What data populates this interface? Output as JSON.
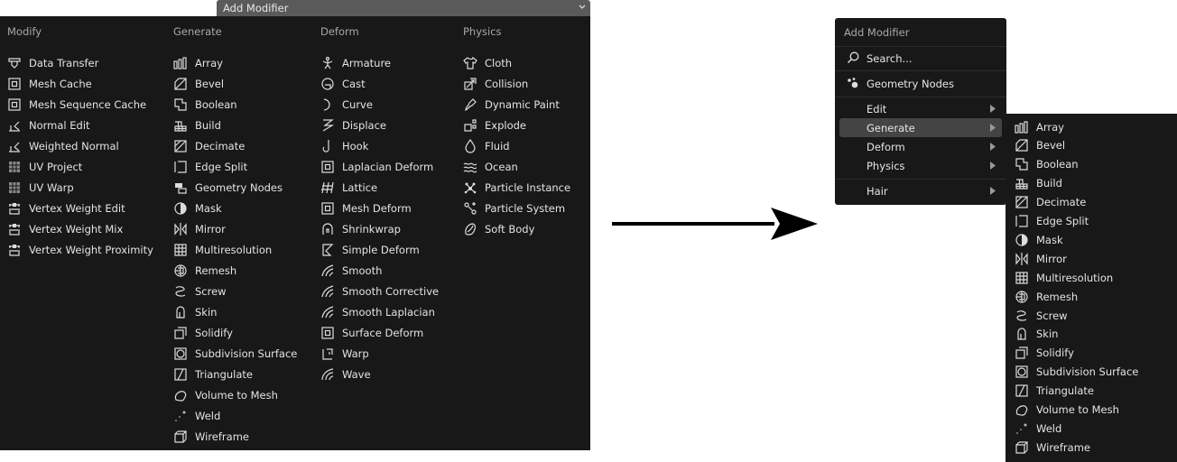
{
  "left_menu": {
    "title": "Add Modifier",
    "columns": [
      {
        "header": "Modify",
        "items": [
          {
            "label": "Data Transfer",
            "icon": "data-transfer-icon"
          },
          {
            "label": "Mesh Cache",
            "icon": "mesh-cache-icon"
          },
          {
            "label": "Mesh Sequence Cache",
            "icon": "mesh-sequence-cache-icon"
          },
          {
            "label": "Normal Edit",
            "icon": "normal-edit-icon"
          },
          {
            "label": "Weighted Normal",
            "icon": "weighted-normal-icon"
          },
          {
            "label": "UV Project",
            "icon": "uv-project-icon"
          },
          {
            "label": "UV Warp",
            "icon": "uv-warp-icon"
          },
          {
            "label": "Vertex Weight Edit",
            "icon": "vertex-weight-icon"
          },
          {
            "label": "Vertex Weight Mix",
            "icon": "vertex-weight-icon"
          },
          {
            "label": "Vertex Weight Proximity",
            "icon": "vertex-weight-icon"
          }
        ]
      },
      {
        "header": "Generate",
        "items": [
          {
            "label": "Array",
            "icon": "array-icon"
          },
          {
            "label": "Bevel",
            "icon": "bevel-icon"
          },
          {
            "label": "Boolean",
            "icon": "boolean-icon"
          },
          {
            "label": "Build",
            "icon": "build-icon"
          },
          {
            "label": "Decimate",
            "icon": "decimate-icon"
          },
          {
            "label": "Edge Split",
            "icon": "edge-split-icon"
          },
          {
            "label": "Geometry Nodes",
            "icon": "geometry-nodes-icon"
          },
          {
            "label": "Mask",
            "icon": "mask-icon"
          },
          {
            "label": "Mirror",
            "icon": "mirror-icon"
          },
          {
            "label": "Multiresolution",
            "icon": "multiresolution-icon"
          },
          {
            "label": "Remesh",
            "icon": "remesh-icon"
          },
          {
            "label": "Screw",
            "icon": "screw-icon"
          },
          {
            "label": "Skin",
            "icon": "skin-icon"
          },
          {
            "label": "Solidify",
            "icon": "solidify-icon"
          },
          {
            "label": "Subdivision Surface",
            "icon": "subdivision-surface-icon"
          },
          {
            "label": "Triangulate",
            "icon": "triangulate-icon"
          },
          {
            "label": "Volume to Mesh",
            "icon": "volume-to-mesh-icon"
          },
          {
            "label": "Weld",
            "icon": "weld-icon"
          },
          {
            "label": "Wireframe",
            "icon": "wireframe-icon"
          }
        ]
      },
      {
        "header": "Deform",
        "items": [
          {
            "label": "Armature",
            "icon": "armature-icon"
          },
          {
            "label": "Cast",
            "icon": "cast-icon"
          },
          {
            "label": "Curve",
            "icon": "curve-icon"
          },
          {
            "label": "Displace",
            "icon": "displace-icon"
          },
          {
            "label": "Hook",
            "icon": "hook-icon"
          },
          {
            "label": "Laplacian Deform",
            "icon": "laplacian-deform-icon"
          },
          {
            "label": "Lattice",
            "icon": "lattice-icon"
          },
          {
            "label": "Mesh Deform",
            "icon": "mesh-deform-icon"
          },
          {
            "label": "Shrinkwrap",
            "icon": "shrinkwrap-icon"
          },
          {
            "label": "Simple Deform",
            "icon": "simple-deform-icon"
          },
          {
            "label": "Smooth",
            "icon": "smooth-icon"
          },
          {
            "label": "Smooth Corrective",
            "icon": "smooth-icon"
          },
          {
            "label": "Smooth Laplacian",
            "icon": "smooth-icon"
          },
          {
            "label": "Surface Deform",
            "icon": "surface-deform-icon"
          },
          {
            "label": "Warp",
            "icon": "warp-icon"
          },
          {
            "label": "Wave",
            "icon": "wave-icon"
          }
        ]
      },
      {
        "header": "Physics",
        "items": [
          {
            "label": "Cloth",
            "icon": "cloth-icon"
          },
          {
            "label": "Collision",
            "icon": "collision-icon"
          },
          {
            "label": "Dynamic Paint",
            "icon": "dynamic-paint-icon"
          },
          {
            "label": "Explode",
            "icon": "explode-icon"
          },
          {
            "label": "Fluid",
            "icon": "fluid-icon"
          },
          {
            "label": "Ocean",
            "icon": "ocean-icon"
          },
          {
            "label": "Particle Instance",
            "icon": "particle-instance-icon"
          },
          {
            "label": "Particle System",
            "icon": "particle-system-icon"
          },
          {
            "label": "Soft Body",
            "icon": "soft-body-icon"
          }
        ]
      }
    ]
  },
  "small_menu": {
    "title": "Add Modifier",
    "search_label": "Search...",
    "geometry_nodes_label": "Geometry Nodes",
    "categories": [
      {
        "label": "Edit"
      },
      {
        "label": "Generate"
      },
      {
        "label": "Deform"
      },
      {
        "label": "Physics"
      }
    ],
    "hair_label": "Hair",
    "highlight_color": "#444444"
  },
  "submenu": {
    "items": [
      {
        "label": "Array",
        "icon": "array-icon"
      },
      {
        "label": "Bevel",
        "icon": "bevel-icon"
      },
      {
        "label": "Boolean",
        "icon": "boolean-icon"
      },
      {
        "label": "Build",
        "icon": "build-icon"
      },
      {
        "label": "Decimate",
        "icon": "decimate-icon"
      },
      {
        "label": "Edge Split",
        "icon": "edge-split-icon"
      },
      {
        "label": "Mask",
        "icon": "mask-icon"
      },
      {
        "label": "Mirror",
        "icon": "mirror-icon"
      },
      {
        "label": "Multiresolution",
        "icon": "multiresolution-icon"
      },
      {
        "label": "Remesh",
        "icon": "remesh-icon"
      },
      {
        "label": "Screw",
        "icon": "screw-icon"
      },
      {
        "label": "Skin",
        "icon": "skin-icon"
      },
      {
        "label": "Solidify",
        "icon": "solidify-icon"
      },
      {
        "label": "Subdivision Surface",
        "icon": "subdivision-surface-icon"
      },
      {
        "label": "Triangulate",
        "icon": "triangulate-icon"
      },
      {
        "label": "Volume to Mesh",
        "icon": "volume-to-mesh-icon"
      },
      {
        "label": "Weld",
        "icon": "weld-icon"
      },
      {
        "label": "Wireframe",
        "icon": "wireframe-icon"
      }
    ]
  },
  "colors": {
    "menu_bg": "#181818",
    "header_bg": "#5a5a5a",
    "text": "#e4e4e4",
    "muted": "#a8a8a8"
  }
}
